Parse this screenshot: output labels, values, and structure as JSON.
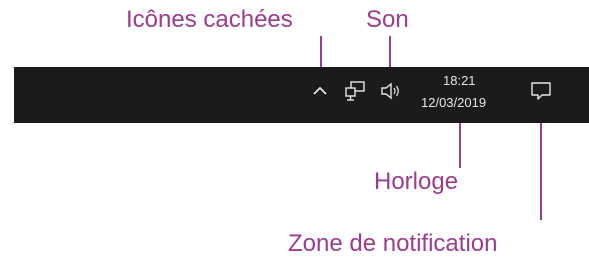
{
  "annotations": {
    "hidden_icons": "Icônes cachées",
    "sound": "Son",
    "clock": "Horloge",
    "notification_area": "Zone de notification"
  },
  "taskbar": {
    "clock": {
      "time": "18:21",
      "date": "12/03/2019"
    },
    "icons": {
      "hidden_icons_chevron": "chevron-up-icon",
      "network": "network-icon",
      "volume": "speaker-icon",
      "notifications": "action-center-icon"
    }
  },
  "colors": {
    "annotation": "#9b3c8f",
    "taskbar_bg": "#1b1b1b",
    "taskbar_fg": "#e6e6e6"
  }
}
